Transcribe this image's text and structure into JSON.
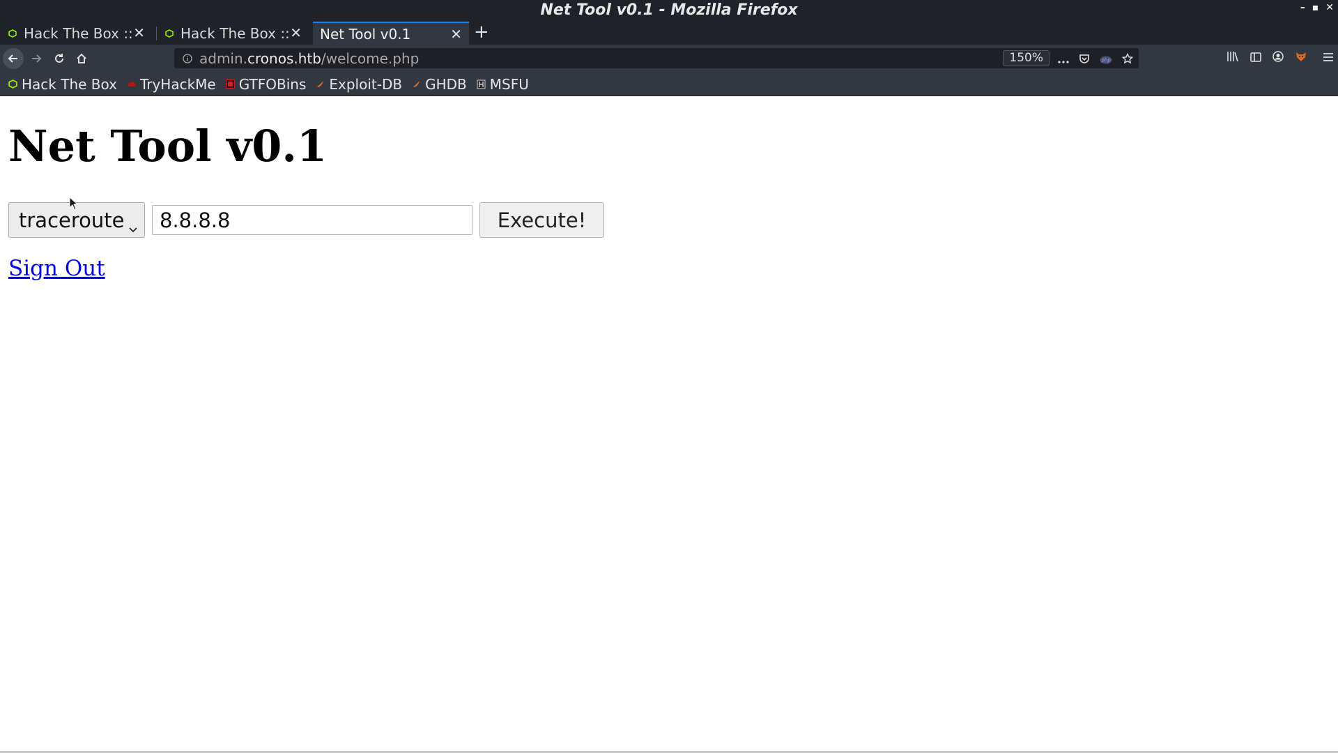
{
  "window": {
    "title": "Net Tool v0.1 - Mozilla Firefox"
  },
  "tabs": [
    {
      "label": "Hack The Box :: M",
      "active": false
    },
    {
      "label": "Hack The Box :: C",
      "active": false
    },
    {
      "label": "Net Tool v0.1",
      "active": true
    }
  ],
  "navbar": {
    "url_scheme_prefix": "admin.",
    "url_host": "cronos.htb",
    "url_path": "/welcome.php",
    "zoom": "150%"
  },
  "bookmarks": [
    {
      "label": "Hack The Box",
      "icon": "htb-icon",
      "color": "#9fef00"
    },
    {
      "label": "TryHackMe",
      "icon": "thm-icon",
      "color": "#c11111"
    },
    {
      "label": "GTFOBins",
      "icon": "gtfobins-icon",
      "color": "#cc2222"
    },
    {
      "label": "Exploit-DB",
      "icon": "exploitdb-icon",
      "color": "#ec6e23"
    },
    {
      "label": "GHDB",
      "icon": "ghdb-icon",
      "color": "#ec6e23"
    },
    {
      "label": "MSFU",
      "icon": "msfu-icon",
      "color": "#cfcfcf"
    }
  ],
  "page": {
    "heading": "Net Tool v0.1",
    "select_value": "traceroute",
    "input_value": "8.8.8.8",
    "execute_label": "Execute!",
    "signout_label": "Sign Out"
  },
  "colors": {
    "tab_active_accent": "#0a84ff",
    "link": "#0000ee"
  }
}
